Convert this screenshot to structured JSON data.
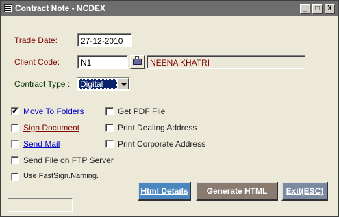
{
  "window": {
    "title": "Contract Note - NCDEX",
    "controls": {
      "minimize": "_",
      "maximize": "□",
      "close": "X"
    }
  },
  "form": {
    "trade_date_label": "Trade Date:",
    "trade_date_value": "27-12-2010",
    "client_code_label": "Client Code:",
    "client_code_value": "N1",
    "client_name_value": "NEENA KHATRI",
    "contract_type_label": "Contract Type :",
    "contract_type_value": "Digital"
  },
  "options": {
    "move_to_folders": {
      "label": "Move To Folders",
      "checked": true
    },
    "sign_document": {
      "label": "Sign Document",
      "checked": false
    },
    "send_mail": {
      "label": "Send Mail",
      "checked": false
    },
    "send_ftp": {
      "label": "Send File on FTP Server",
      "checked": false
    },
    "use_fastsign": {
      "label": "Use FastSign.Naming.",
      "checked": false
    },
    "get_pdf": {
      "label": "Get PDF File",
      "checked": false
    },
    "print_dealing": {
      "label": "Print Dealing Address",
      "checked": false
    },
    "print_corporate": {
      "label": "Print Corporate Address",
      "checked": false
    }
  },
  "buttons": {
    "html_details": "Html Details",
    "generate_html": "Generate HTML",
    "exit": "Exit(ESC)"
  },
  "colors": {
    "titlebar": "#6e6e6e",
    "label": "#800000",
    "link": "#0000cc",
    "html_details_button": "#4a86bf",
    "generate_button": "#8a7b70",
    "exit_button": "#7a8aa0"
  }
}
